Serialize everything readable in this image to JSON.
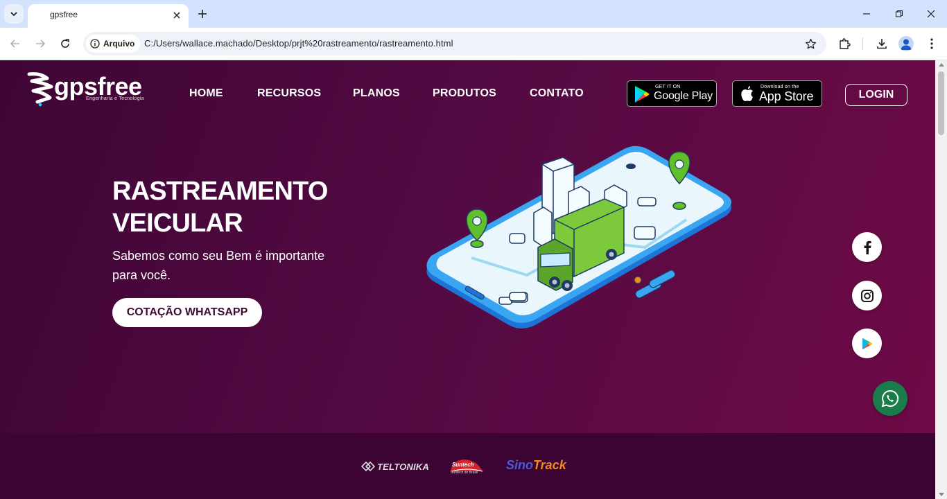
{
  "browser": {
    "tab_title": "gpsfree",
    "site_chip": "Arquivo",
    "url": "C:/Users/wallace.machado/Desktop/prjt%20rastreamento/rastreamento.html"
  },
  "site": {
    "brand_name": "gpsfree",
    "brand_tagline": "Engenharia e Tecnologia",
    "nav": [
      "HOME",
      "RECURSOS",
      "PLANOS",
      "PRODUTOS",
      "CONTATO"
    ],
    "google_play": {
      "small": "GET IT ON",
      "big": "Google Play"
    },
    "app_store": {
      "small": "Download on the",
      "big": "App Store"
    },
    "login": "LOGIN"
  },
  "hero": {
    "title": "RASTREAMENTO VEICULAR",
    "subtitle": "Sabemos como seu Bem é importante para você.",
    "cta": "COTAÇÃO WHATSAPP"
  },
  "partners": {
    "teltonika": "TELTONIKA",
    "suntech_name": "Suntech",
    "suntech_sub": "Suntech do Brasil",
    "sino": "Sino",
    "track": "Track"
  },
  "colors": {
    "hero_start": "#3f0535",
    "hero_end": "#6e0a47",
    "band": "#3c0432",
    "whatsapp": "#1b7c4b",
    "tabbar": "#d3e3fd"
  }
}
